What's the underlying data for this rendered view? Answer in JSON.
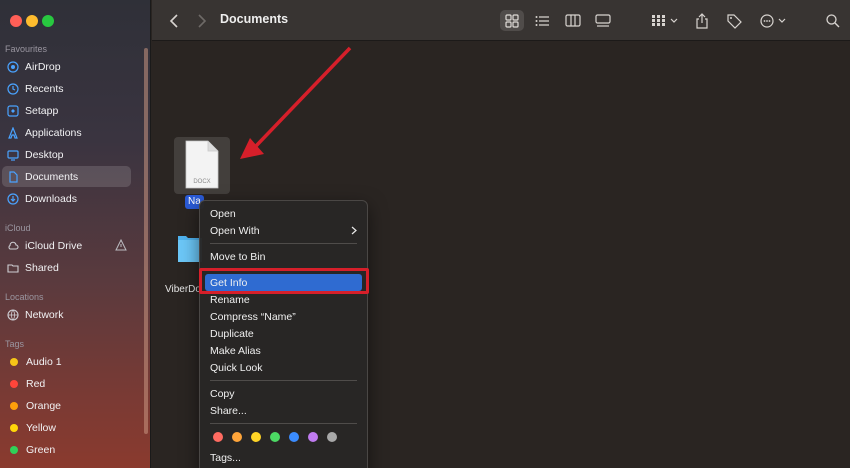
{
  "window": {
    "title": "Documents"
  },
  "sidebar": {
    "sections": {
      "favourites": "Favourites",
      "icloud": "iCloud",
      "locations": "Locations",
      "tags": "Tags"
    },
    "favourites": [
      {
        "label": "AirDrop",
        "icon": "airdrop-icon"
      },
      {
        "label": "Recents",
        "icon": "clock-icon"
      },
      {
        "label": "Setapp",
        "icon": "setapp-icon"
      },
      {
        "label": "Applications",
        "icon": "applications-icon"
      },
      {
        "label": "Desktop",
        "icon": "desktop-icon"
      },
      {
        "label": "Documents",
        "icon": "document-icon",
        "active": true
      },
      {
        "label": "Downloads",
        "icon": "download-icon"
      }
    ],
    "icloud": [
      {
        "label": "iCloud Drive",
        "icon": "cloud-icon"
      },
      {
        "label": "Shared",
        "icon": "shared-folder-icon"
      }
    ],
    "locations": [
      {
        "label": "Network",
        "icon": "network-icon"
      }
    ],
    "tags": [
      {
        "label": "Audio 1",
        "color": "#f5c518"
      },
      {
        "label": "Red",
        "color": "#ff453a"
      },
      {
        "label": "Orange",
        "color": "#ff9f0a"
      },
      {
        "label": "Yellow",
        "color": "#ffd60a"
      },
      {
        "label": "Green",
        "color": "#30d158"
      }
    ]
  },
  "toolbar": {
    "icons": [
      "back-icon",
      "forward-icon",
      "grid-view-icon",
      "list-view-icon",
      "column-view-icon",
      "gallery-view-icon",
      "group-icon",
      "share-icon",
      "tag-icon",
      "more-icon",
      "search-icon"
    ]
  },
  "files": {
    "selected_file": {
      "name": "Na",
      "type_badge": "DOCX"
    },
    "folder": {
      "name": "ViberDo"
    }
  },
  "context_menu": {
    "items": [
      {
        "label": "Open"
      },
      {
        "label": "Open With",
        "submenu": true
      },
      {
        "label": "Move to Bin"
      },
      {
        "label": "Get Info",
        "highlighted": true
      },
      {
        "label": "Rename"
      },
      {
        "label": "Compress “Name”"
      },
      {
        "label": "Duplicate"
      },
      {
        "label": "Make Alias"
      },
      {
        "label": "Quick Look"
      },
      {
        "label": "Copy"
      },
      {
        "label": "Share..."
      },
      {
        "label": "Tags..."
      }
    ],
    "tag_colors": [
      "#ff6b61",
      "#ffa53a",
      "#ffd426",
      "#4cd964",
      "#3b8cff",
      "#c07bf0",
      "#a8a8a8"
    ]
  },
  "colors": {
    "accent": "#2f6bd1",
    "annotation_red": "#d61f2a"
  }
}
